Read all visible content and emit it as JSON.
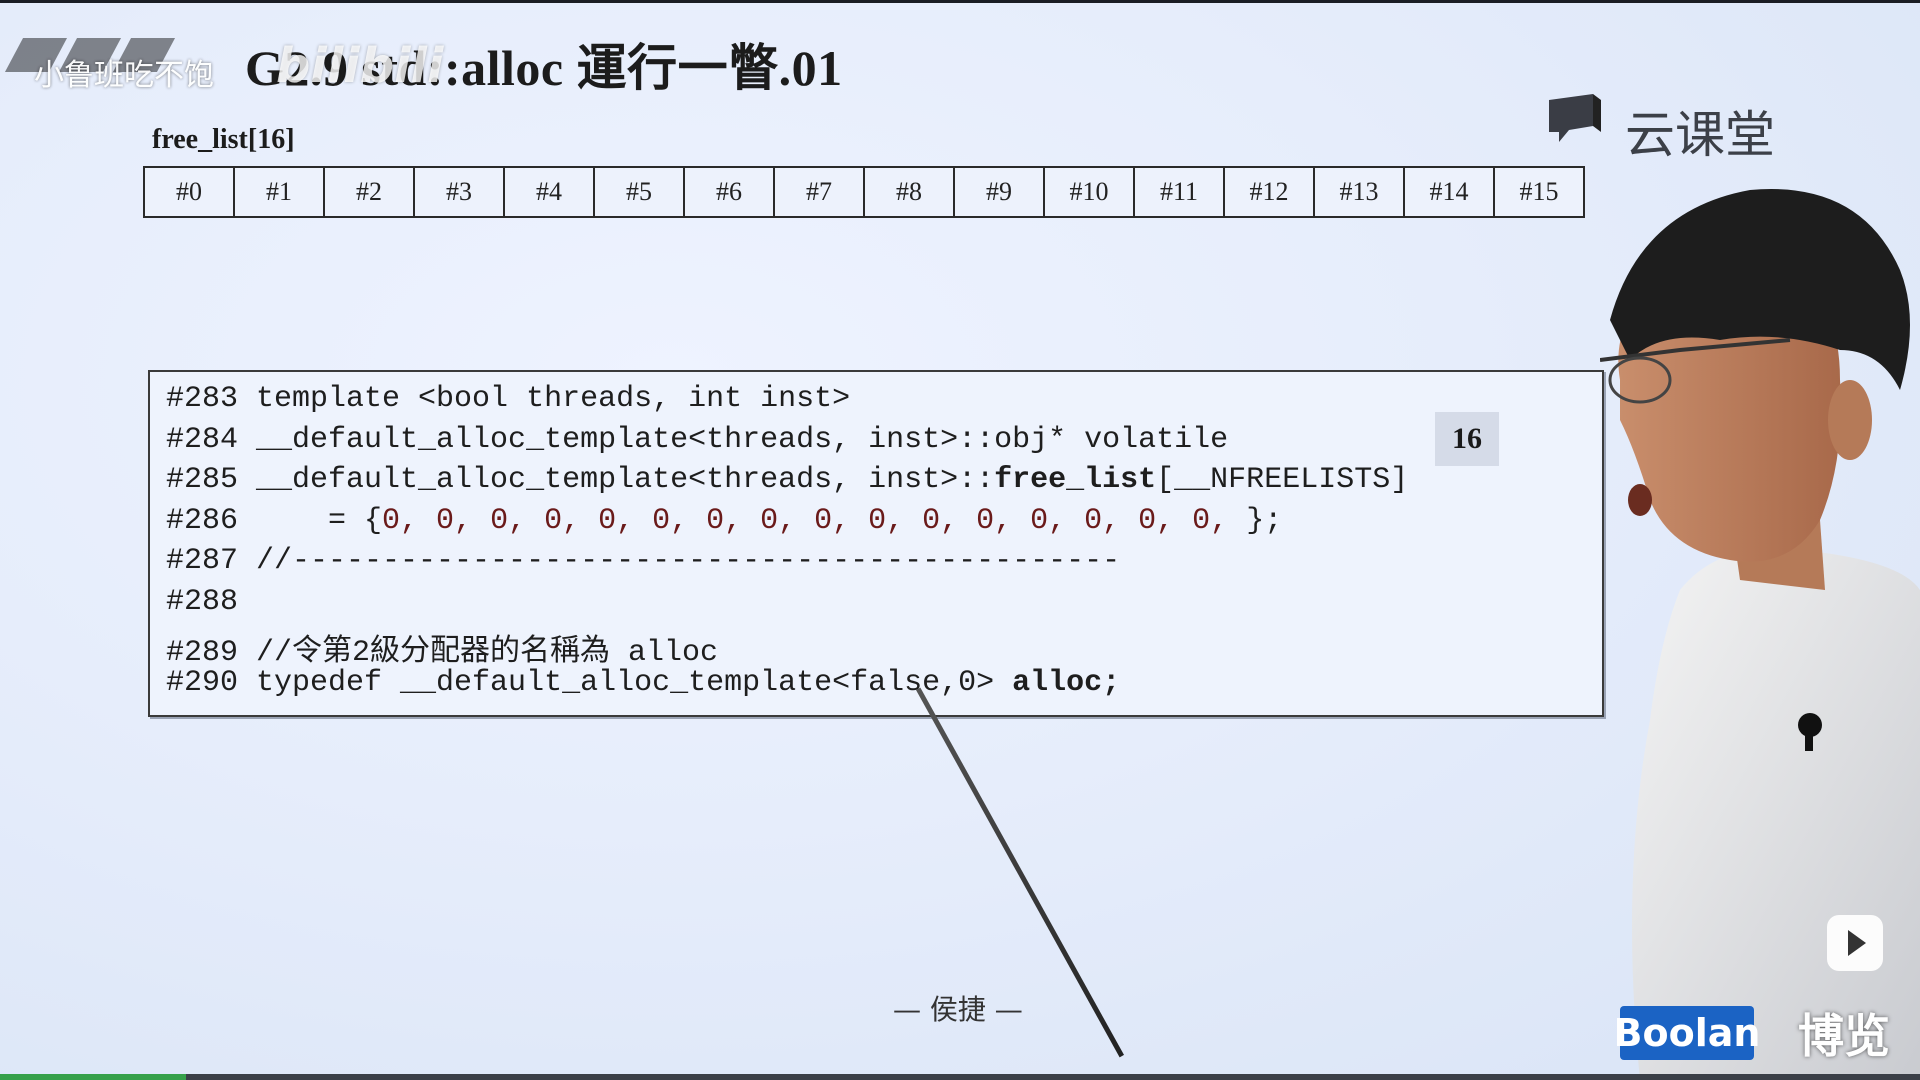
{
  "watermark": {
    "channel": "小鲁班吃不饱",
    "logo": "bilibili"
  },
  "slide": {
    "title": "G2.9 std::alloc 運行一瞥.01",
    "free_list_label": "free_list[16]",
    "free_list_cells": [
      "#0",
      "#1",
      "#2",
      "#3",
      "#4",
      "#5",
      "#6",
      "#7",
      "#8",
      "#9",
      "#10",
      "#11",
      "#12",
      "#13",
      "#14",
      "#15"
    ],
    "badge": "16",
    "footer": "— 侯捷 —"
  },
  "code": [
    {
      "num": "#283",
      "text": " template <bool threads, int inst>"
    },
    {
      "num": "#284",
      "text": " __default_alloc_template<threads, inst>::obj* volatile"
    },
    {
      "num": "#285",
      "text": " __default_alloc_template<threads, inst>::",
      "bold": "free_list",
      "rest": "[__NFREELISTS]"
    },
    {
      "num": "#286",
      "text": "     = {",
      "zeros": "0, 0, 0, 0, 0, 0, 0, 0, 0, 0, 0, 0, 0, 0, 0, 0,",
      "rest": " };"
    },
    {
      "num": "#287",
      "text": " //----------------------------------------------"
    },
    {
      "num": "#288",
      "text": ""
    },
    {
      "num": "#289",
      "text": " //令第2級分配器的名稱為 alloc"
    },
    {
      "num": "#290",
      "text": " typedef __default_alloc_template<false,0> ",
      "bold": "alloc;",
      "rest": ""
    }
  ],
  "branding": {
    "yun_text": "云课堂",
    "boolan": "Boolan",
    "boolan_cn": "博览"
  },
  "player": {
    "progress_fraction": 0.097
  }
}
